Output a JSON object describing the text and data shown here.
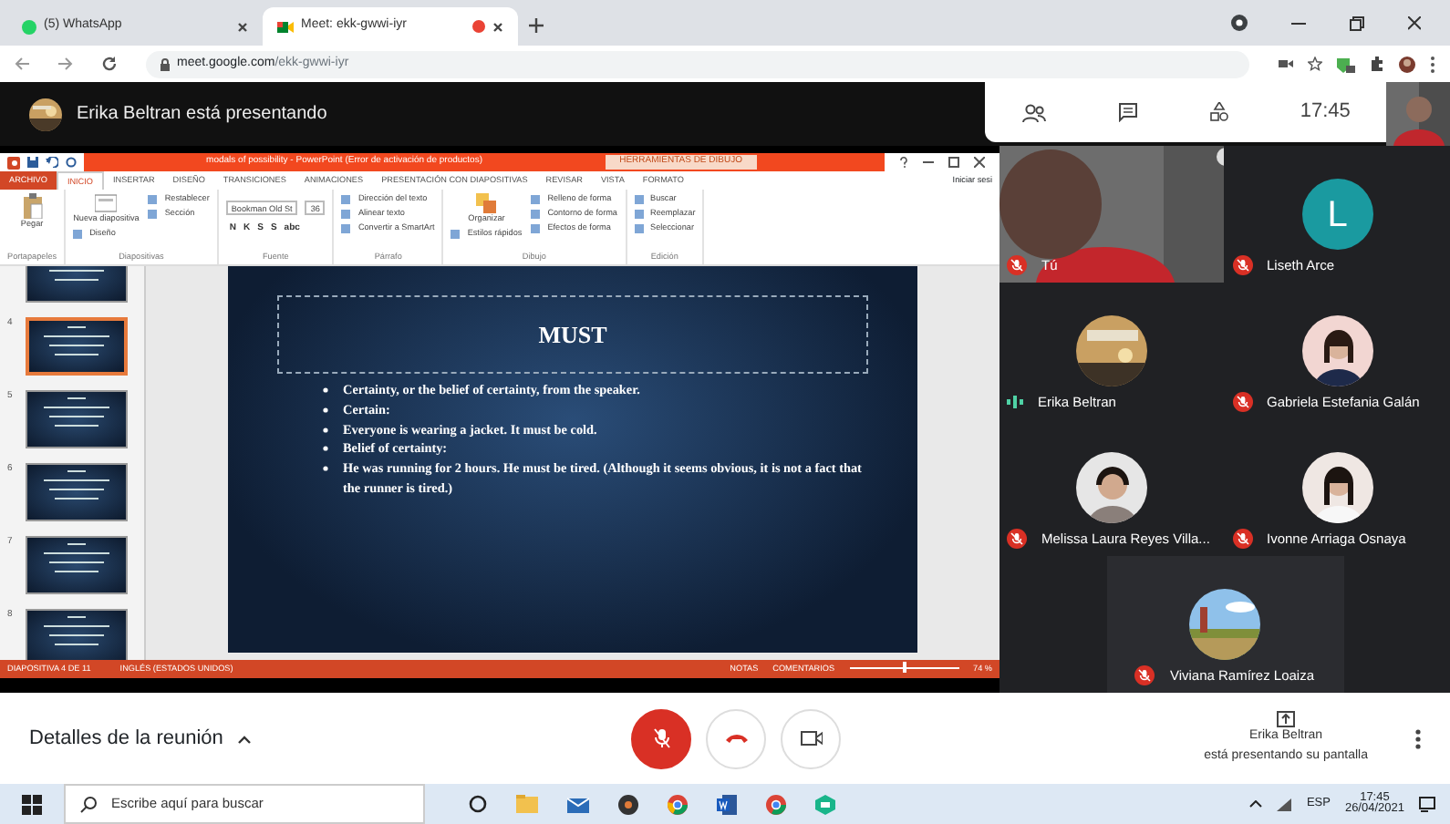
{
  "browser": {
    "tabs": [
      {
        "title": "(5) WhatsApp",
        "selected": false,
        "recording": false
      },
      {
        "title": "Meet: ekk-gwwi-iyr",
        "selected": true,
        "recording": true
      }
    ],
    "url_host": "meet.google.com",
    "url_path": "/ekk-gwwi-iyr"
  },
  "meet_header": {
    "presenter_text": "Erika Beltran está presentando",
    "time": "17:45"
  },
  "presentation": {
    "title_bar": "modals of possibility - PowerPoint (Error de activación de productos)",
    "contextual_tab": "HERRAMIENTAS DE DIBUJO",
    "ribbon_tabs": [
      {
        "label": "ARCHIVO",
        "selected": false,
        "kind": "file"
      },
      {
        "label": "INICIO",
        "selected": true,
        "kind": "tab"
      },
      {
        "label": "INSERTAR",
        "selected": false,
        "kind": "tab"
      },
      {
        "label": "DISEÑO",
        "selected": false,
        "kind": "tab"
      },
      {
        "label": "TRANSICIONES",
        "selected": false,
        "kind": "tab"
      },
      {
        "label": "ANIMACIONES",
        "selected": false,
        "kind": "tab"
      },
      {
        "label": "PRESENTACIÓN CON DIAPOSITIVAS",
        "selected": false,
        "kind": "tab"
      },
      {
        "label": "REVISAR",
        "selected": false,
        "kind": "tab"
      },
      {
        "label": "VISTA",
        "selected": false,
        "kind": "tab"
      },
      {
        "label": "FORMATO",
        "selected": false,
        "kind": "tab"
      }
    ],
    "account": "Iniciar sesi",
    "ribbon_groups": [
      {
        "label": "Portapapeles",
        "kind": "commands",
        "commands": [
          "Pegar"
        ]
      },
      {
        "label": "Diapositivas",
        "kind": "commands",
        "commands": [
          "Nueva diapositiva",
          "Diseño",
          "Restablecer",
          "Sección"
        ]
      },
      {
        "label": "Fuente",
        "kind": "font",
        "font_name": "Bookman Old St",
        "font_size": "36",
        "format_buttons": [
          "N",
          "K",
          "S",
          "S",
          "abc"
        ]
      },
      {
        "label": "Párrafo",
        "kind": "commands",
        "commands": [
          "Dirección del texto",
          "Alinear texto",
          "Convertir a SmartArt"
        ]
      },
      {
        "label": "Dibujo",
        "kind": "commands",
        "commands": [
          "Organizar",
          "Estilos rápidos",
          "Relleno de forma",
          "Contorno de forma",
          "Efectos de forma"
        ]
      },
      {
        "label": "Edición",
        "kind": "commands",
        "commands": [
          "Buscar",
          "Reemplazar",
          "Seleccionar"
        ]
      }
    ],
    "thumbnails": [
      {
        "selected": false
      },
      {
        "number": "4",
        "selected": true
      },
      {
        "number": "5",
        "selected": false
      },
      {
        "number": "6",
        "selected": false
      },
      {
        "number": "7",
        "selected": false
      },
      {
        "number": "8",
        "selected": false
      }
    ],
    "slide": {
      "title": "MUST",
      "bullets": [
        "Certainty, or the belief of certainty, from the speaker.",
        "Certain:",
        "Everyone is wearing a jacket. It must be cold.",
        "Belief of certainty:",
        "He was running for 2 hours. He must be tired. (Although it seems obvious, it is not a fact that the runner is tired.)"
      ]
    },
    "status_bar": {
      "slide_counter": "DIAPOSITIVA 4 DE 11",
      "language": "INGLÉS (ESTADOS UNIDOS)",
      "notes": "NOTAS",
      "comments": "COMENTARIOS",
      "zoom": "74 %",
      "level": 0.5
    }
  },
  "participants": [
    {
      "name": "Tú",
      "muted": true,
      "kind": "video"
    },
    {
      "name": "Liseth Arce",
      "muted": true,
      "kind": "letter",
      "letter": "L",
      "color": "#1a9aa0"
    },
    {
      "name": "Erika Beltran",
      "muted": false
    },
    {
      "name": "Gabriela Estefania Galán",
      "muted": true
    },
    {
      "name": "Melissa Laura Reyes Villa...",
      "muted": true
    },
    {
      "name": "Ivonne Arriaga Osnaya",
      "muted": true
    },
    {
      "name": "Viviana Ramírez Loaiza",
      "muted": true
    }
  ],
  "bottom_bar": {
    "meeting_details": "Detalles de la reunión",
    "mic_muted": true,
    "presenter_name": "Erika Beltran",
    "presenter_status": "está presentando su pantalla"
  },
  "taskbar": {
    "search_placeholder": "Escribe aquí para buscar",
    "language": "ESP",
    "time": "17:45",
    "date": "26/04/2021"
  }
}
